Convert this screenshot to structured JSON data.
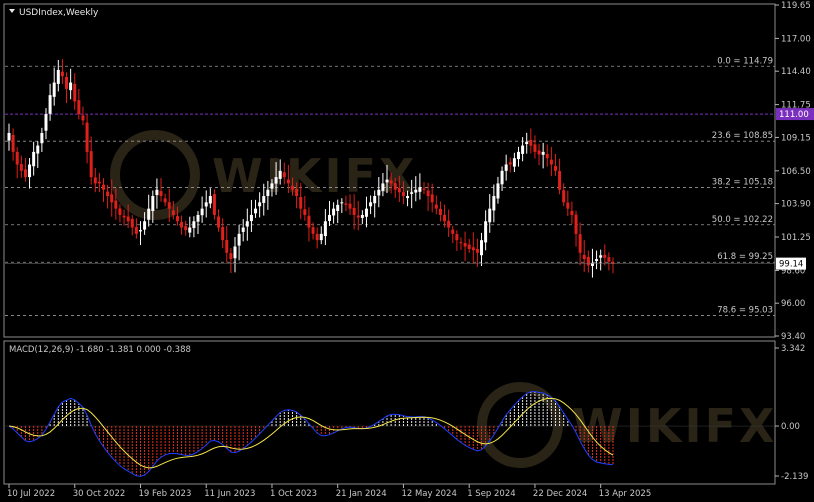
{
  "chart_data": {
    "type": "candlestick",
    "symbol_label": "USDIndex,Weekly",
    "price_axis": {
      "ylim": [
        93.4,
        119.65
      ],
      "tick_labels": [
        "119.65",
        "117.00",
        "114.40",
        "111.75",
        "109.15",
        "106.50",
        "103.90",
        "101.25",
        "98.60",
        "96.00",
        "93.40"
      ],
      "tick_values": [
        119.65,
        117.0,
        114.4,
        111.75,
        109.15,
        106.5,
        103.9,
        101.25,
        98.6,
        96.0,
        93.4
      ]
    },
    "current_price": {
      "value": 99.14,
      "label": "99.14"
    },
    "highlight_level": {
      "value": 111.0,
      "label": "111.00",
      "color": "#7b2fbe"
    },
    "fibonacci_levels": [
      {
        "text": "0.0 = 114.79",
        "value": 114.79
      },
      {
        "text": "23.6 = 108.85",
        "value": 108.85
      },
      {
        "text": "38.2 = 105.18",
        "value": 105.18
      },
      {
        "text": "50.0 = 102.22",
        "value": 102.22
      },
      {
        "text": "61.8 = 99.25",
        "value": 99.25
      },
      {
        "text": "78.6 = 95.03",
        "value": 95.03
      }
    ],
    "x_tick_labels": [
      "10 Jul 2022",
      "30 Oct 2022",
      "19 Feb 2023",
      "11 Jun 2023",
      "1 Oct 2023",
      "21 Jan 2024",
      "12 May 2024",
      "1 Sep 2024",
      "22 Dec 2024",
      "13 Apr 2025"
    ],
    "x_tick_index": [
      0,
      16,
      32,
      48,
      64,
      80,
      96,
      112,
      128,
      144
    ],
    "closes": [
      109.5,
      108.0,
      107.0,
      106.5,
      106.0,
      107.0,
      108.0,
      108.5,
      109.5,
      111.0,
      112.5,
      113.5,
      114.5,
      114.0,
      113.0,
      113.5,
      112.0,
      111.0,
      110.5,
      108.0,
      106.0,
      105.5,
      105.5,
      105.0,
      104.5,
      104.0,
      103.5,
      103.0,
      102.8,
      102.5,
      102.0,
      101.5,
      101.8,
      102.5,
      103.5,
      104.5,
      105.0,
      104.5,
      104.0,
      103.5,
      103.0,
      102.5,
      102.0,
      101.8,
      102.0,
      102.5,
      103.0,
      103.5,
      104.0,
      104.5,
      103.0,
      102.0,
      101.0,
      100.0,
      99.5,
      100.5,
      101.5,
      102.0,
      102.5,
      103.0,
      103.5,
      104.0,
      104.5,
      105.0,
      105.5,
      106.0,
      106.5,
      106.0,
      105.5,
      105.0,
      104.5,
      103.5,
      103.0,
      102.0,
      101.5,
      101.0,
      101.5,
      102.5,
      103.0,
      103.5,
      103.8,
      104.0,
      103.8,
      103.5,
      103.0,
      102.8,
      103.0,
      103.5,
      104.0,
      104.5,
      105.0,
      105.5,
      105.8,
      105.5,
      105.0,
      104.8,
      104.5,
      104.5,
      104.8,
      105.0,
      105.2,
      105.0,
      104.5,
      104.0,
      103.5,
      103.0,
      102.5,
      102.0,
      101.5,
      101.0,
      100.8,
      100.5,
      100.3,
      100.2,
      100.0,
      101.0,
      102.5,
      103.5,
      104.5,
      105.5,
      106.5,
      107.0,
      107.0,
      107.5,
      108.0,
      108.5,
      108.8,
      108.5,
      108.0,
      107.8,
      108.0,
      107.5,
      107.0,
      106.5,
      105.0,
      104.0,
      103.5,
      103.0,
      101.5,
      100.0,
      99.5,
      99.0,
      99.2,
      99.5,
      99.8,
      99.6,
      99.3,
      99.14
    ],
    "macd": {
      "label": "MACD(12,26,9) -1.680 -1.381 0.000 -0.388",
      "params": "12,26,9",
      "ylim": [
        -2.139,
        3.342
      ],
      "tick_labels": [
        "3.342",
        "0.00",
        "-2.139"
      ],
      "tick_values": [
        3.342,
        0.0,
        -2.139
      ],
      "line_color": "#1e3fff",
      "signal_color": "#f5e64a",
      "pos_color": "#e8e8e8",
      "neg_color": "#e0301e"
    },
    "colors": {
      "up": "#ffffff",
      "down": "#e0201a",
      "grid": "#9a9a9a",
      "axis": "#b5b5b5",
      "bg": "#000000"
    },
    "watermark": "WIKIFX",
    "grid": false
  }
}
